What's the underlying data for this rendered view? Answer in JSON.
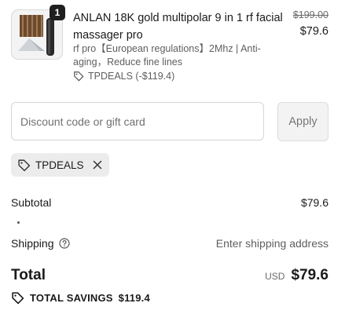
{
  "product": {
    "quantity": "1",
    "title": "ANLAN 18K gold multipolar 9 in 1 rf facial massager pro",
    "variant": "rf pro【European regulations】2Mhz | Anti-aging，Reduce fine lines",
    "discount": "TPDEALS (-$119.4)",
    "original_price": "$199.00",
    "price": "$79.6"
  },
  "discount_form": {
    "placeholder": "Discount code or gift card",
    "apply_label": "Apply"
  },
  "applied_code": {
    "label": "TPDEALS"
  },
  "summary": {
    "subtotal_label": "Subtotal",
    "subtotal_value": "$79.6",
    "shipping_label": "Shipping",
    "shipping_value": "Enter shipping address",
    "total_label": "Total",
    "currency": "USD",
    "total_value": "$79.6",
    "savings_label": "TOTAL SAVINGS",
    "savings_value": "$119.4"
  },
  "colors": {
    "text": "#1a1a1a",
    "muted": "#707070",
    "chip_bg": "#ececec",
    "button_bg": "#f3f3f3"
  },
  "icons": [
    "tag-icon",
    "close-icon",
    "help-icon"
  ]
}
